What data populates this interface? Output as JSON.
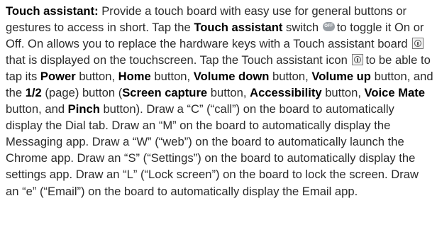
{
  "section": {
    "heading": "Touch assistant:",
    "s1": " Provide a touch board with easy use for general buttons or gestures to access in short. Tap the ",
    "t_switch": "Touch assistant",
    "s2": " switch ",
    "switch_icon_text": "OFF",
    "s3": "to toggle it On or Off. On allows you to replace the hardware keys with a Touch assistant board ",
    "s4": "that is displayed on the touchscreen. Tap the Touch assistant icon ",
    "s5": "to be able to tap its ",
    "t_power": "Power",
    "s6": " button, ",
    "t_home": "Home",
    "s7": " button, ",
    "t_voldown": "Volume down",
    "s8": " button, ",
    "t_volup": "Volume up",
    "s9": " button, and the ",
    "t_page": "1/2",
    "s10": " (page) button (",
    "t_capture": "Screen capture",
    "s11": " button, ",
    "t_access": "Accessibility",
    "s12": " button, ",
    "t_voice": "Voice Mate",
    "s13": " button, and ",
    "t_pinch": "Pinch",
    "s14": " button). Draw a “C” (“call”) on the board to automatically display the Dial tab. Draw an “M” on the board to automatically display the Messaging app. Draw a “W” (“web”) on the board to automatically launch the Chrome app. Draw an “S” (“Settings”) on the board to automatically display the settings app. Draw an “L” (“Lock screen”) on the board to lock the screen. Draw an “e” (“Email”) on the board to automatically display the Email app."
  },
  "icons": {
    "switch": "toggle-switch-off-icon",
    "assistant": "touch-assistant-icon"
  }
}
